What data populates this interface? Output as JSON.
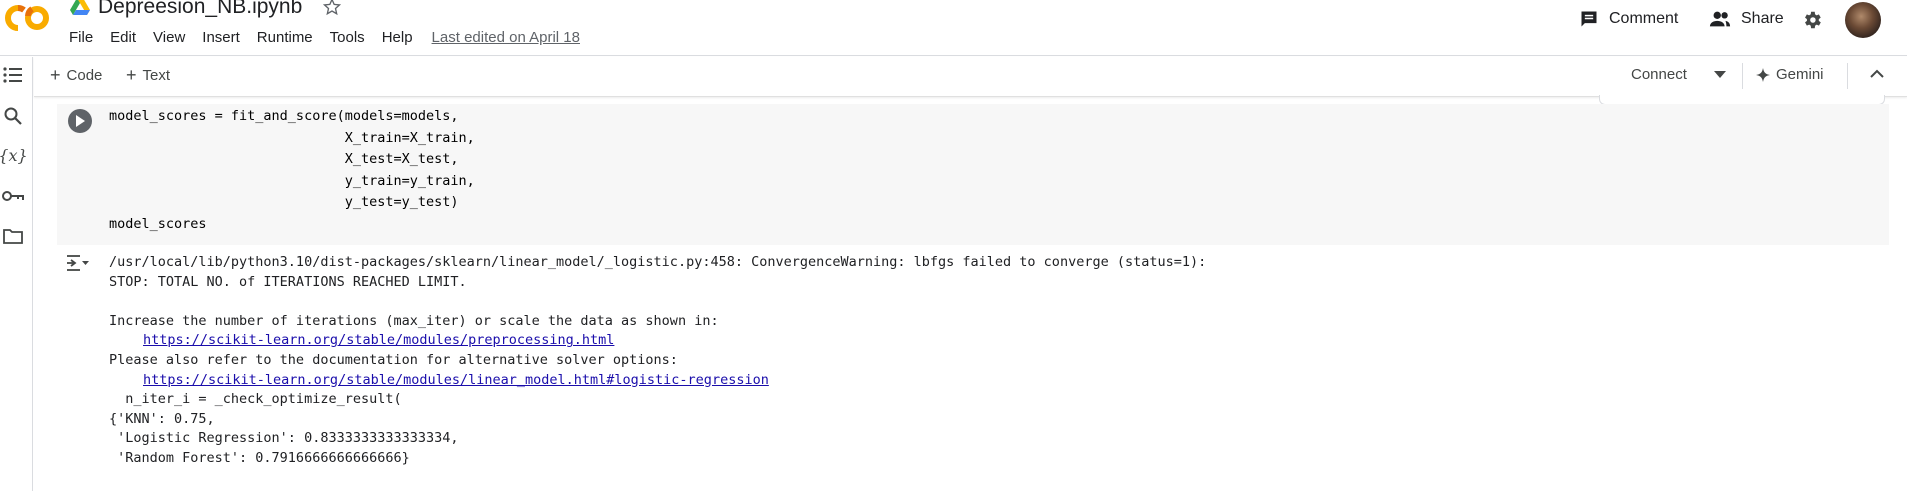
{
  "app": {
    "notebook_title": "Depreesion_NB.ipynb",
    "menu": [
      "File",
      "Edit",
      "View",
      "Insert",
      "Runtime",
      "Tools",
      "Help"
    ],
    "last_edited": "Last edited on April 18",
    "comment_label": "Comment",
    "share_label": "Share",
    "brand_color": "#f9ab00",
    "logo_text": "CO"
  },
  "toolbar": {
    "code_label": "Code",
    "text_label": "Text",
    "connect_label": "Connect",
    "gemini_label": "Gemini"
  },
  "sidebar": {
    "icons": [
      "toc-icon",
      "search-icon",
      "variables-icon",
      "key-icon",
      "folder-icon"
    ]
  },
  "cell": {
    "code_lines": [
      "model_scores = fit_and_score(models=models,",
      "                             X_train=X_train,",
      "                             X_test=X_test,",
      "                             y_train=y_train,",
      "                             y_test=y_test)",
      "model_scores"
    ],
    "output": {
      "warning_line": "/usr/local/lib/python3.10/dist-packages/sklearn/linear_model/_logistic.py:458: ConvergenceWarning: lbfgs failed to converge (status=1):",
      "stop_line": "STOP: TOTAL NO. of ITERATIONS REACHED LIMIT.",
      "increase_line": "Increase the number of iterations (max_iter) or scale the data as shown in:",
      "link1": "https://scikit-learn.org/stable/modules/preprocessing.html",
      "refer_line": "Please also refer to the documentation for alternative solver options:",
      "link2": "https://scikit-learn.org/stable/modules/linear_model.html#logistic-regression",
      "niter_line": "  n_iter_i = _check_optimize_result(",
      "result_lines": [
        "{'KNN': 0.75,",
        " 'Logistic Regression': 0.8333333333333334,",
        " 'Random Forest': 0.7916666666666666}"
      ]
    }
  }
}
